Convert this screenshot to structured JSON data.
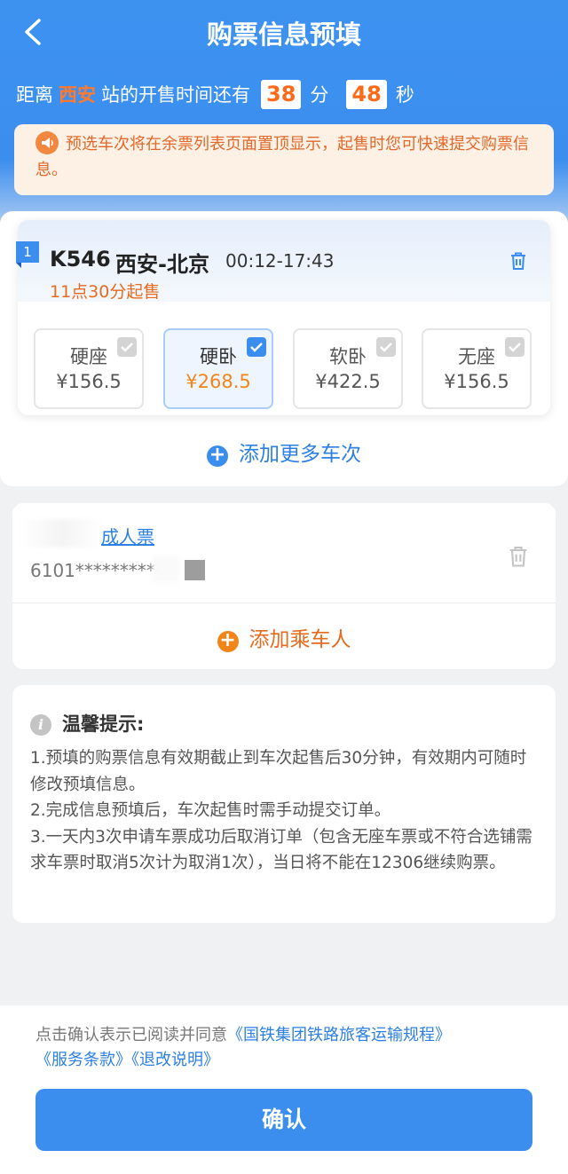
{
  "header": {
    "title": "购票信息预填"
  },
  "countdown": {
    "prefix": "距离",
    "station": "西安",
    "middle": "站的开售时间还有",
    "minutes": "38",
    "minutes_unit": "分",
    "seconds": "48",
    "seconds_unit": "秒"
  },
  "notice": {
    "text": "预选车次将在余票列表页面置顶显示，起售时您可快速提交购票信息。"
  },
  "train": {
    "index": "1",
    "number": "K546",
    "route": "西安-北京",
    "time": "00:12-17:43",
    "sale_time": "11点30分起售",
    "seats": [
      {
        "name": "硬座",
        "price": "¥156.5",
        "selected": false
      },
      {
        "name": "硬卧",
        "price": "¥268.5",
        "selected": true
      },
      {
        "name": "软卧",
        "price": "¥422.5",
        "selected": false
      },
      {
        "name": "无座",
        "price": "¥156.5",
        "selected": false
      }
    ]
  },
  "add_train": {
    "label": "添加更多车次"
  },
  "passenger": {
    "ticket_type": "成人票",
    "id_number": "6101***********"
  },
  "add_passenger": {
    "label": "添加乘车人"
  },
  "tips": {
    "title": "温馨提示:",
    "items": [
      "1.预填的购票信息有效期截止到车次起售后30分钟，有效期内可随时修改预填信息。",
      "2.完成信息预填后，车次起售时需手动提交订单。",
      "3.一天内3次申请车票成功后取消订单（包含无座车票或不符合选铺需求车票时取消5次计为取消1次），当日将不能在12306继续购票。"
    ]
  },
  "agreement": {
    "prefix": "点击确认表示已阅读并同意",
    "link1": "《国铁集团铁路旅客运输规程》",
    "link2": "《服务条款》",
    "link3": "《退改说明》"
  },
  "confirm": {
    "label": "确认"
  },
  "colors": {
    "primary": "#3c8eee",
    "accent": "#f1851a",
    "notice_bg": "#fdf1e5"
  }
}
